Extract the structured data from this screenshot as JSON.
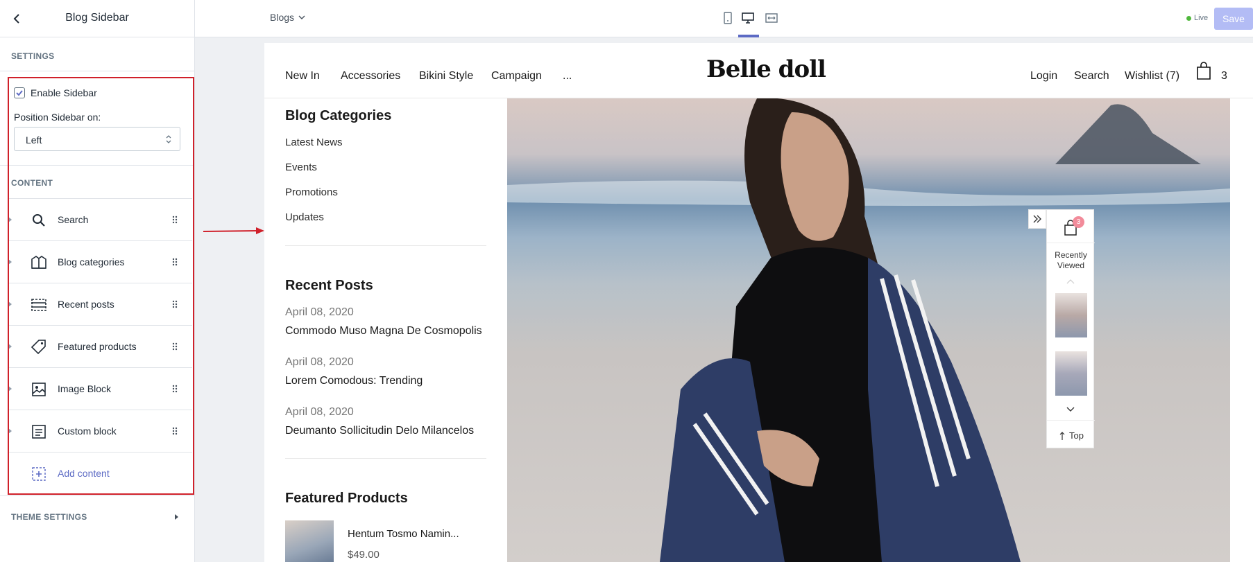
{
  "editor": {
    "title": "Blog Sidebar",
    "settings_label": "SETTINGS",
    "enable_sidebar": "Enable Sidebar",
    "position_label": "Position Sidebar on:",
    "position_value": "Left",
    "content_label": "CONTENT",
    "blocks": [
      {
        "label": "Search",
        "icon": "search-icon"
      },
      {
        "label": "Blog categories",
        "icon": "blog-categories-icon"
      },
      {
        "label": "Recent posts",
        "icon": "recent-posts-icon"
      },
      {
        "label": "Featured products",
        "icon": "tag-icon"
      },
      {
        "label": "Image Block",
        "icon": "image-icon"
      },
      {
        "label": "Custom block",
        "icon": "document-icon"
      }
    ],
    "add_content": "Add content",
    "theme_settings": "THEME SETTINGS"
  },
  "topbar": {
    "page_select": "Blogs",
    "live_label": "Live",
    "save_label": "Save",
    "accent": "#5c6ac4"
  },
  "store": {
    "nav": [
      "New In",
      "Accessories",
      "Bikini Style",
      "Campaign",
      "..."
    ],
    "logo": "Belle doll",
    "login": "Login",
    "search": "Search",
    "wishlist": "Wishlist (7)",
    "cart_count": "3"
  },
  "sidebar": {
    "categories_title": "Blog Categories",
    "categories": [
      "Latest News",
      "Events",
      "Promotions",
      "Updates"
    ],
    "recent_title": "Recent Posts",
    "posts": [
      {
        "date": "April 08, 2020",
        "title": "Commodo Muso Magna De Cosmopolis"
      },
      {
        "date": "April 08, 2020",
        "title": "Lorem Comodous: Trending"
      },
      {
        "date": "April 08, 2020",
        "title": "Deumanto Sollicitudin Delo Milancelos"
      }
    ],
    "featured_title": "Featured Products",
    "product_name": "Hentum Tosmo Namin...",
    "product_price": "$49.00"
  },
  "floating": {
    "badge": "3",
    "recently": "Recently Viewed",
    "top": "Top"
  }
}
